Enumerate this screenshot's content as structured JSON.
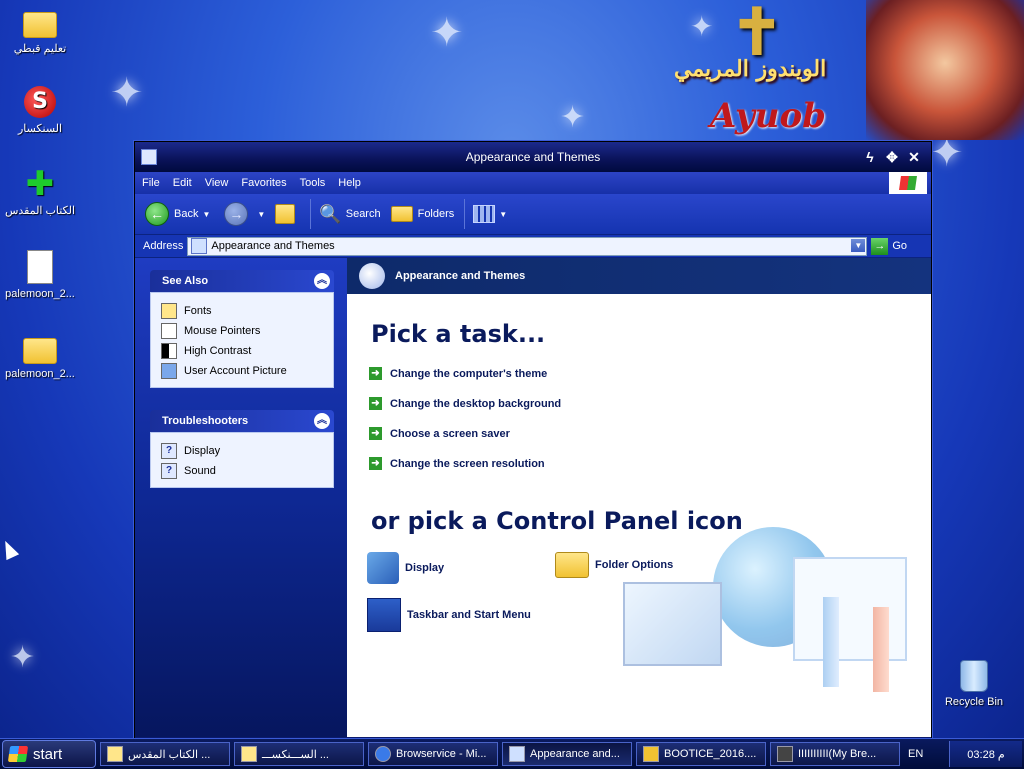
{
  "desktop": {
    "icons": [
      {
        "label": "تعليم قبطي",
        "icon": "folder-icon"
      },
      {
        "label": "السنكسار",
        "icon": "app-shortcut-icon"
      },
      {
        "label": "الكتاب المقدس",
        "icon": "app-shortcut-icon"
      },
      {
        "label": "palemoon_2...",
        "icon": "document-icon"
      },
      {
        "label": "palemoon_2...",
        "icon": "folder-icon"
      },
      {
        "label": "Recycle Bin",
        "icon": "recycle-bin-icon"
      }
    ],
    "banner": {
      "arabic_text": "الويندوز المريمي",
      "name": "Ayuob"
    }
  },
  "window": {
    "title": "Appearance and Themes",
    "menu": [
      "File",
      "Edit",
      "View",
      "Favorites",
      "Tools",
      "Help"
    ],
    "toolbar": {
      "back": "Back",
      "search": "Search",
      "folders": "Folders"
    },
    "address": {
      "label": "Address",
      "value": "Appearance and Themes",
      "go": "Go"
    },
    "see_also": {
      "title": "See Also",
      "items": [
        "Fonts",
        "Mouse Pointers",
        "High Contrast",
        "User Account Picture"
      ]
    },
    "troubleshooters": {
      "title": "Troubleshooters",
      "items": [
        "Display",
        "Sound"
      ]
    },
    "header_title": "Appearance and Themes",
    "pick_task": "Pick a task...",
    "tasks": [
      "Change the computer's theme",
      "Change the desktop background",
      "Choose a screen saver",
      "Change the screen resolution"
    ],
    "pick_icon": "or pick a Control Panel icon",
    "cp_icons": [
      "Display",
      "Folder Options",
      "Taskbar and Start Menu"
    ]
  },
  "taskbar": {
    "start": "start",
    "buttons": [
      "الكتاب المقدس ...",
      "الســـنكســـ ...",
      "Browservice - Mi...",
      "Appearance and...",
      "BOOTICE_2016....",
      "IIIIIIIIII(My Bre..."
    ],
    "lang": "EN",
    "clock": "03:28 م"
  }
}
